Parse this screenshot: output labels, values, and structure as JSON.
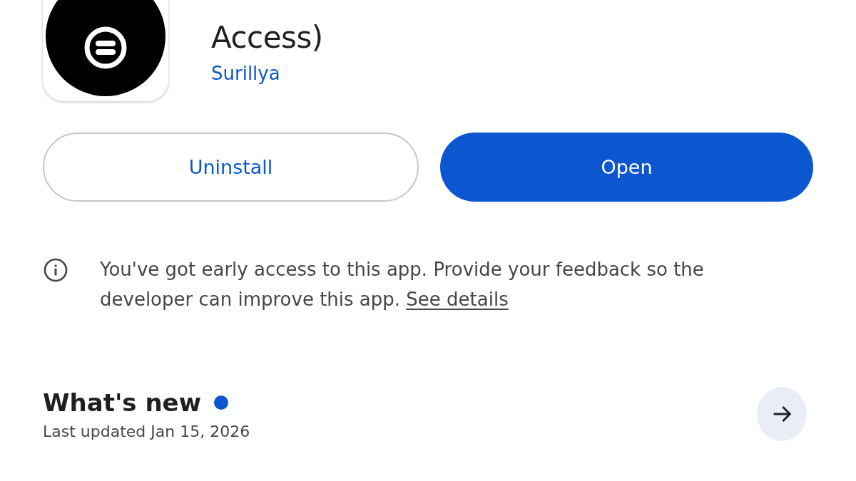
{
  "app": {
    "title": "Access)",
    "developer": "Surillya"
  },
  "buttons": [
    {
      "label": "Uninstall",
      "kind": "outline"
    },
    {
      "label": "Open",
      "kind": "filled"
    }
  ],
  "notice": {
    "text": "You've got early access to this app. Provide your feedback so the developer can improve this app.",
    "link": "See details"
  },
  "whats_new": {
    "title": "What's new",
    "unread": true,
    "subtitle": "Last updated Jan 15, 2026"
  }
}
